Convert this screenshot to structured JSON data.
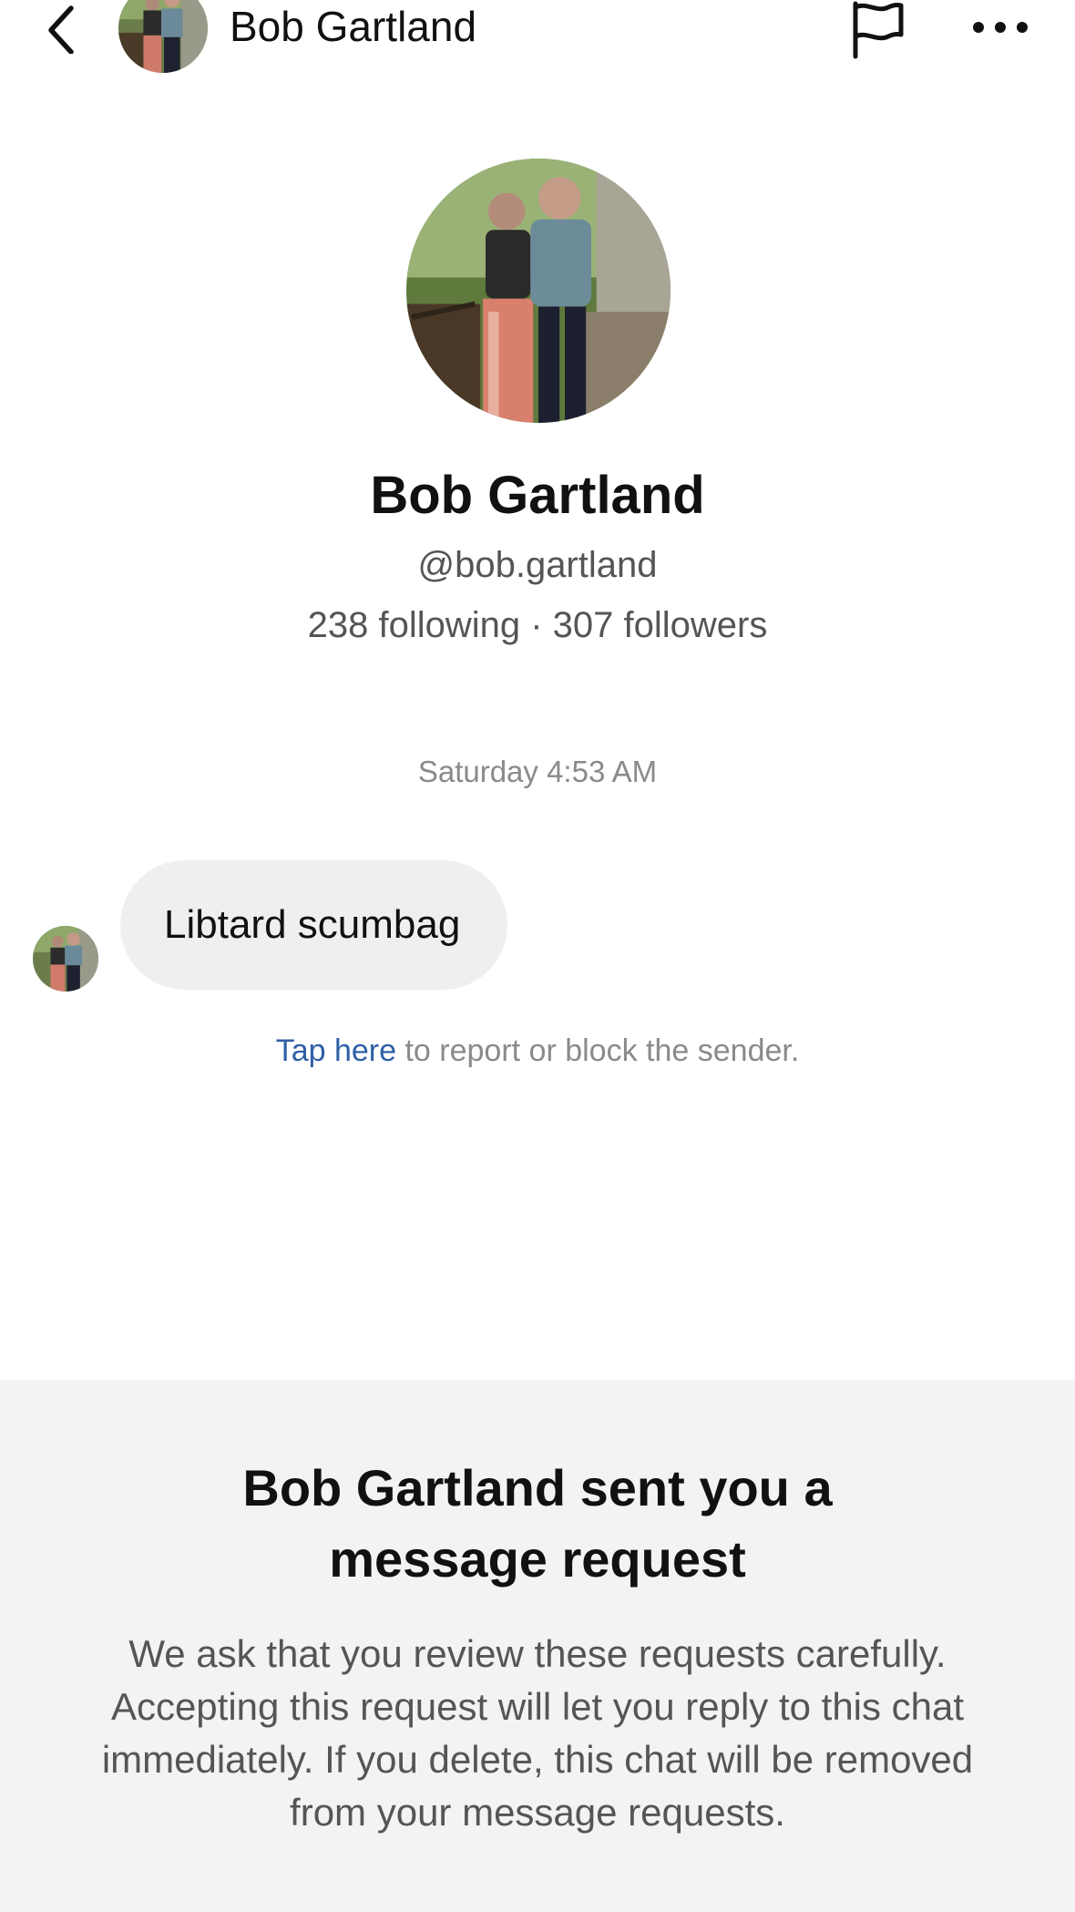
{
  "header": {
    "name": "Bob Gartland",
    "back_icon": "chevron-left-icon",
    "flag_icon": "flag-icon",
    "more_icon": "ellipsis-horizontal-icon"
  },
  "profile": {
    "name": "Bob Gartland",
    "handle": "@bob.gartland",
    "stats": "238 following · 307 followers"
  },
  "conversation": {
    "timestamp": "Saturday 4:53 AM",
    "messages": [
      {
        "text": "Libtard scumbag"
      }
    ],
    "report_link": "Tap here",
    "report_rest": " to report or block the sender."
  },
  "request": {
    "title": "Bob Gartland sent you a message request",
    "body": "We ask that you review these requests carefully. Accepting this request will let you reply to this chat immediately. If you delete, this chat will be removed from your message requests."
  },
  "colors": {
    "link": "#2f5fa6",
    "bubble": "#efefef",
    "panel": "#f3f3f3",
    "secondary_text": "#555555"
  }
}
